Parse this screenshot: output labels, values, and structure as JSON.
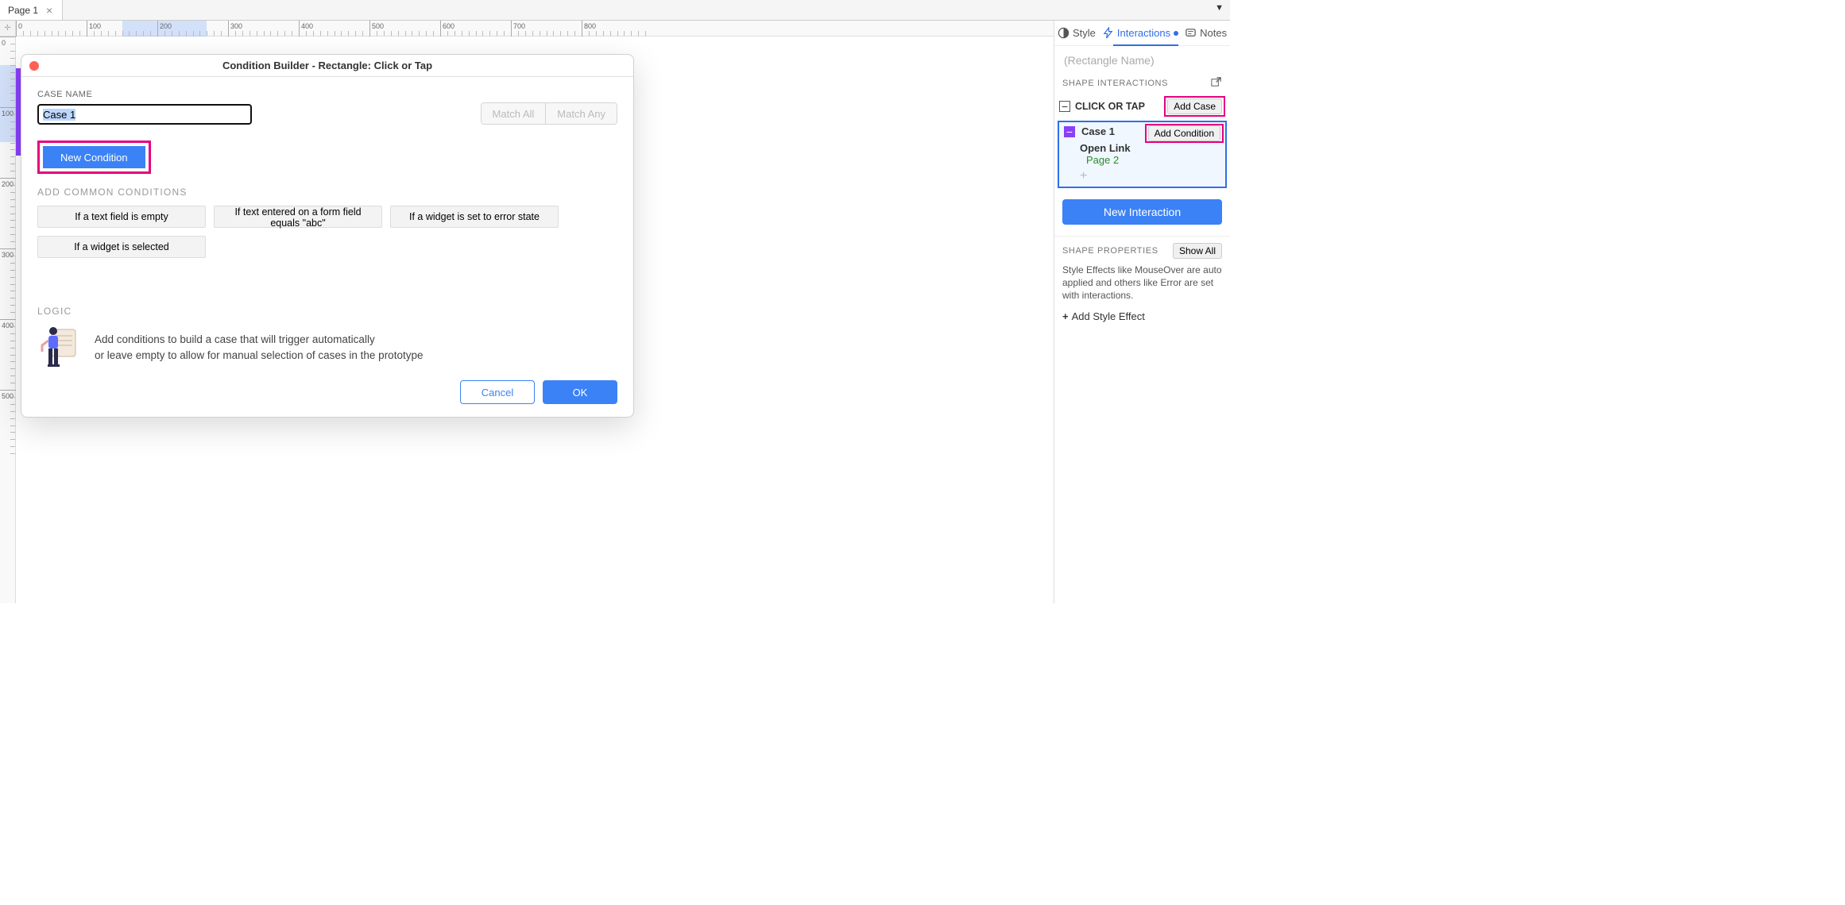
{
  "tabs": {
    "page1": "Page 1"
  },
  "ruler": {
    "marks": [
      0,
      100,
      200,
      300,
      400,
      500,
      600,
      700,
      800
    ],
    "vmarks": [
      0,
      100,
      200,
      300,
      400,
      500
    ],
    "hsel_start": 150,
    "hsel_end": 270,
    "vsel_start": 40,
    "vsel_end": 150
  },
  "dialog": {
    "title": "Condition Builder   -   Rectangle: Click or Tap",
    "case_name_label": "CASE NAME",
    "case_name_value": "Case 1",
    "match_all": "Match All",
    "match_any": "Match Any",
    "new_condition": "New Condition",
    "common_label": "ADD COMMON CONDITIONS",
    "common": {
      "c1": "If a text field is empty",
      "c2": "If text entered on a form field equals \"abc\"",
      "c3": "If a widget is set to error state",
      "c4": "If a widget is selected"
    },
    "logic_label": "LOGIC",
    "logic_text_1": "Add conditions to build a case that will trigger automatically",
    "logic_text_2": "or leave empty to allow for manual selection of cases in the prototype",
    "cancel": "Cancel",
    "ok": "OK"
  },
  "right": {
    "tab_style": "Style",
    "tab_interactions": "Interactions",
    "tab_notes": "Notes",
    "widget_name_placeholder": "(Rectangle Name)",
    "section_interactions": "SHAPE INTERACTIONS",
    "event_label": "CLICK OR TAP",
    "add_case": "Add Case",
    "case_name": "Case 1",
    "add_condition": "Add Condition",
    "action_name": "Open Link",
    "action_target": "Page 2",
    "new_interaction": "New Interaction",
    "props_head": "SHAPE PROPERTIES",
    "show_all": "Show All",
    "props_desc": "Style Effects like MouseOver are auto applied and others like Error are set with interactions.",
    "add_style_effect": "Add Style Effect"
  }
}
